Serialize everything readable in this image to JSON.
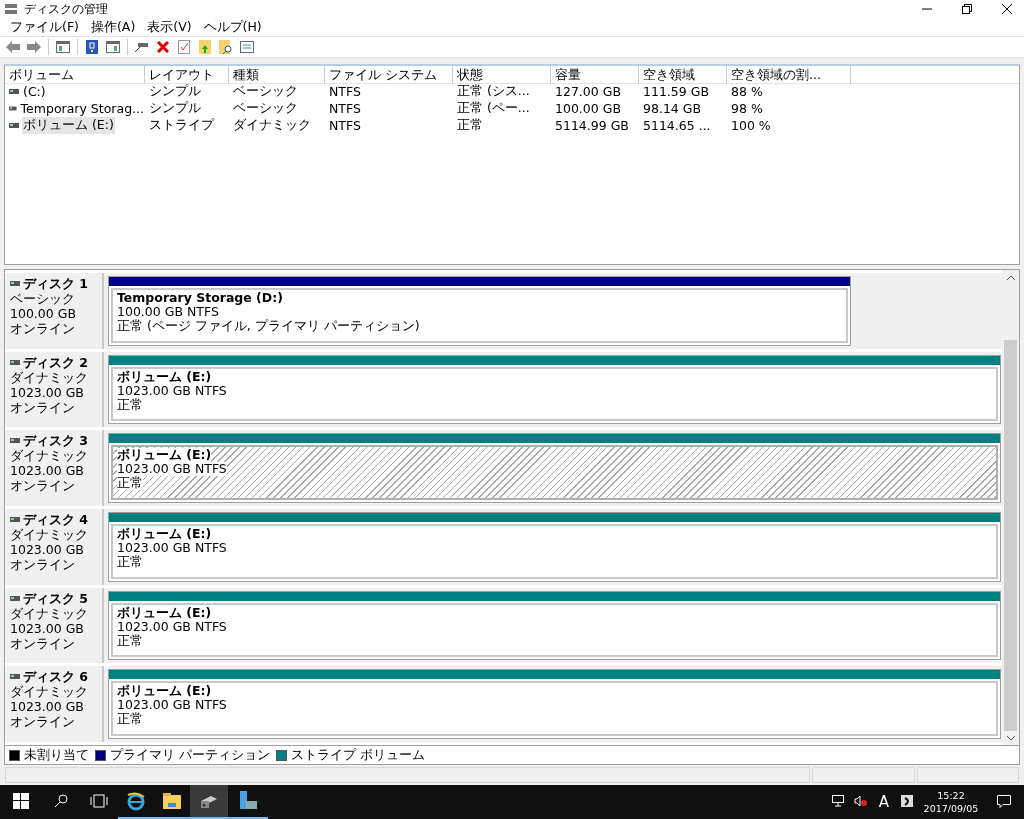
{
  "window": {
    "title": "ディスクの管理"
  },
  "menu": [
    "ファイル(F)",
    "操作(A)",
    "表示(V)",
    "ヘルプ(H)"
  ],
  "volume_table": {
    "columns": [
      "ボリューム",
      "レイアウト",
      "種類",
      "ファイル システム",
      "状態",
      "容量",
      "空き領域",
      "空き領域の割..."
    ],
    "rows": [
      {
        "selected": false,
        "cells": [
          "(C:)",
          "シンプル",
          "ベーシック",
          "NTFS",
          "正常 (シス...",
          "127.00 GB",
          "111.59 GB",
          "88 %"
        ]
      },
      {
        "selected": false,
        "cells": [
          "Temporary Storag...",
          "シンプル",
          "ベーシック",
          "NTFS",
          "正常 (ペー...",
          "100.00 GB",
          "98.14 GB",
          "98 %"
        ]
      },
      {
        "selected": true,
        "cells": [
          "ボリューム (E:)",
          "ストライプ",
          "ダイナミック",
          "NTFS",
          "正常",
          "5114.99 GB",
          "5114.65 ...",
          "100 %"
        ]
      }
    ]
  },
  "disks": [
    {
      "name": "ディスク 1",
      "type": "ベーシック",
      "size": "100.00 GB",
      "status": "オンライン",
      "partition": {
        "kind": "primary",
        "color": "#000080",
        "selected": false,
        "name": "Temporary Storage  (D:)",
        "size": "100.00 GB NTFS",
        "status": "正常 (ページ ファイル, プライマリ パーティション)"
      }
    },
    {
      "name": "ディスク 2",
      "type": "ダイナミック",
      "size": "1023.00 GB",
      "status": "オンライン",
      "partition": {
        "kind": "striped",
        "color": "#008080",
        "selected": false,
        "name": "ボリューム  (E:)",
        "size": "1023.00 GB NTFS",
        "status": "正常"
      }
    },
    {
      "name": "ディスク 3",
      "type": "ダイナミック",
      "size": "1023.00 GB",
      "status": "オンライン",
      "partition": {
        "kind": "striped",
        "color": "#008080",
        "selected": true,
        "name": "ボリューム  (E:)",
        "size": "1023.00 GB NTFS",
        "status": "正常"
      }
    },
    {
      "name": "ディスク 4",
      "type": "ダイナミック",
      "size": "1023.00 GB",
      "status": "オンライン",
      "partition": {
        "kind": "striped",
        "color": "#008080",
        "selected": false,
        "name": "ボリューム  (E:)",
        "size": "1023.00 GB NTFS",
        "status": "正常"
      }
    },
    {
      "name": "ディスク 5",
      "type": "ダイナミック",
      "size": "1023.00 GB",
      "status": "オンライン",
      "partition": {
        "kind": "striped",
        "color": "#008080",
        "selected": false,
        "name": "ボリューム  (E:)",
        "size": "1023.00 GB NTFS",
        "status": "正常"
      }
    },
    {
      "name": "ディスク 6",
      "type": "ダイナミック",
      "size": "1023.00 GB",
      "status": "オンライン",
      "partition": {
        "kind": "striped",
        "color": "#008080",
        "selected": false,
        "name": "ボリューム  (E:)",
        "size": "1023.00 GB NTFS",
        "status": "正常"
      }
    }
  ],
  "legend": [
    {
      "label": "未割り当て",
      "color": "#000000"
    },
    {
      "label": "プライマリ パーティション",
      "color": "#000080"
    },
    {
      "label": "ストライプ ボリューム",
      "color": "#008080"
    }
  ],
  "taskbar": {
    "ime": "A",
    "time": "15:22",
    "date": "2017/09/05"
  }
}
